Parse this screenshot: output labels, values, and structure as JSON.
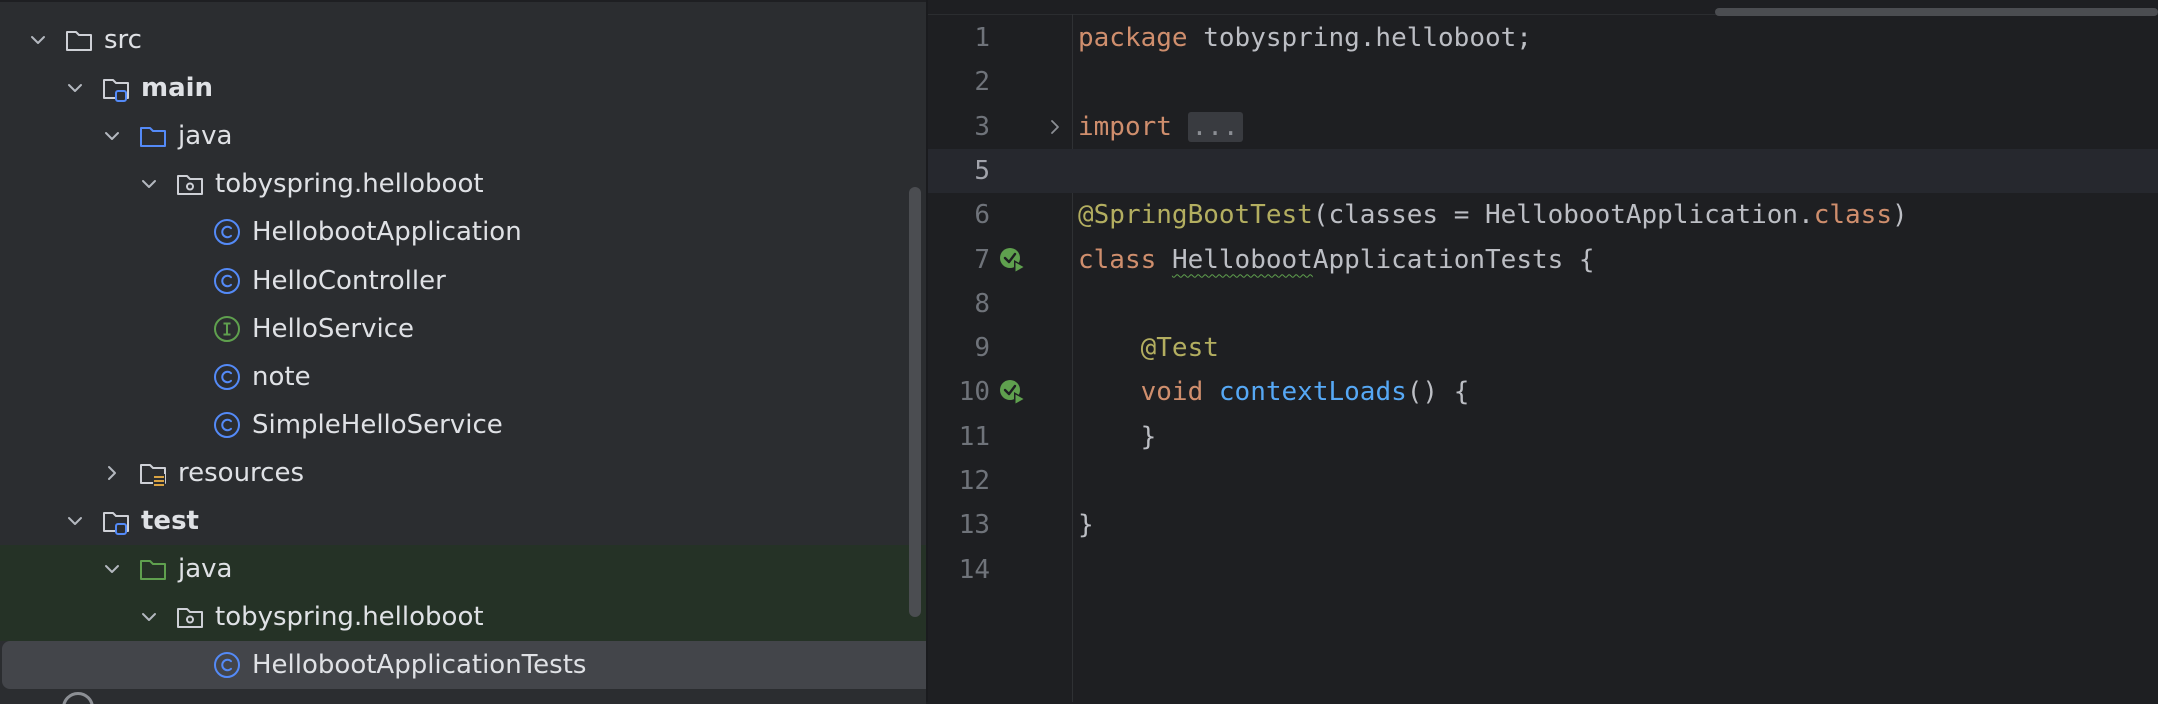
{
  "project_tree": {
    "items": [
      {
        "label": "src",
        "depth": 0,
        "expanded": true,
        "icon": "folder-icon",
        "bold": false
      },
      {
        "label": "main",
        "depth": 1,
        "expanded": true,
        "icon": "source-root-folder-icon",
        "bold": true
      },
      {
        "label": "java",
        "depth": 2,
        "expanded": true,
        "icon": "source-folder-icon",
        "bold": false
      },
      {
        "label": "tobyspring.helloboot",
        "depth": 3,
        "expanded": true,
        "icon": "package-icon",
        "bold": false
      },
      {
        "label": "HellobootApplication",
        "depth": 4,
        "expanded": null,
        "icon": "class-icon",
        "bold": false
      },
      {
        "label": "HelloController",
        "depth": 4,
        "expanded": null,
        "icon": "class-icon",
        "bold": false
      },
      {
        "label": "HelloService",
        "depth": 4,
        "expanded": null,
        "icon": "interface-icon",
        "bold": false
      },
      {
        "label": "note",
        "depth": 4,
        "expanded": null,
        "icon": "class-icon",
        "bold": false
      },
      {
        "label": "SimpleHelloService",
        "depth": 4,
        "expanded": null,
        "icon": "class-icon",
        "bold": false
      },
      {
        "label": "resources",
        "depth": 2,
        "expanded": false,
        "icon": "resources-folder-icon",
        "bold": false
      },
      {
        "label": "test",
        "depth": 1,
        "expanded": true,
        "icon": "source-root-folder-icon",
        "bold": true
      },
      {
        "label": "java",
        "depth": 2,
        "expanded": true,
        "icon": "test-folder-icon",
        "bold": false
      },
      {
        "label": "tobyspring.helloboot",
        "depth": 3,
        "expanded": true,
        "icon": "package-icon",
        "bold": false
      },
      {
        "label": "HellobootApplicationTests",
        "depth": 4,
        "expanded": null,
        "icon": "class-icon",
        "bold": false
      }
    ],
    "selected_label": "HellobootApplicationTests"
  },
  "editor": {
    "lines": [
      {
        "number": "1",
        "tokens": [
          {
            "t": "package",
            "c": "kw"
          },
          {
            "t": " tobyspring.helloboot;",
            "c": "plain"
          }
        ]
      },
      {
        "number": "2",
        "tokens": []
      },
      {
        "number": "3",
        "tokens": [
          {
            "t": "import",
            "c": "kw"
          },
          {
            "t": " ",
            "c": "plain"
          },
          {
            "t": "...",
            "c": "folded"
          }
        ],
        "fold": true
      },
      {
        "number": "5",
        "tokens": [],
        "current": true
      },
      {
        "number": "6",
        "tokens": [
          {
            "t": "@SpringBootTest",
            "c": "ann"
          },
          {
            "t": "(classes = HellobootApplication.",
            "c": "plain"
          },
          {
            "t": "class",
            "c": "kw"
          },
          {
            "t": ")",
            "c": "plain"
          }
        ]
      },
      {
        "number": "7",
        "tokens": [
          {
            "t": "class",
            "c": "kw"
          },
          {
            "t": " ",
            "c": "plain"
          },
          {
            "t": "Helloboot",
            "c": "squiggle"
          },
          {
            "t": "ApplicationTests {",
            "c": "plain"
          }
        ],
        "run_icon": true
      },
      {
        "number": "8",
        "tokens": []
      },
      {
        "number": "9",
        "tokens": [
          {
            "t": "    ",
            "c": "plain"
          },
          {
            "t": "@Test",
            "c": "ann"
          }
        ]
      },
      {
        "number": "10",
        "tokens": [
          {
            "t": "    ",
            "c": "plain"
          },
          {
            "t": "void",
            "c": "kw"
          },
          {
            "t": " ",
            "c": "plain"
          },
          {
            "t": "contextLoads",
            "c": "fn"
          },
          {
            "t": "() {",
            "c": "plain"
          }
        ],
        "run_icon": true
      },
      {
        "number": "11",
        "tokens": [
          {
            "t": "    }",
            "c": "plain"
          }
        ]
      },
      {
        "number": "12",
        "tokens": []
      },
      {
        "number": "13",
        "tokens": [
          {
            "t": "}",
            "c": "plain"
          }
        ]
      },
      {
        "number": "14",
        "tokens": []
      }
    ]
  },
  "colors": {
    "keyword": "#cf8e6d",
    "annotation": "#b3ae60",
    "function": "#56a8f5",
    "text": "#bcbec4",
    "class_icon": "#548af7",
    "interface_icon": "#5fa04e",
    "test_tint": "#253226",
    "selection": "#43454a"
  }
}
